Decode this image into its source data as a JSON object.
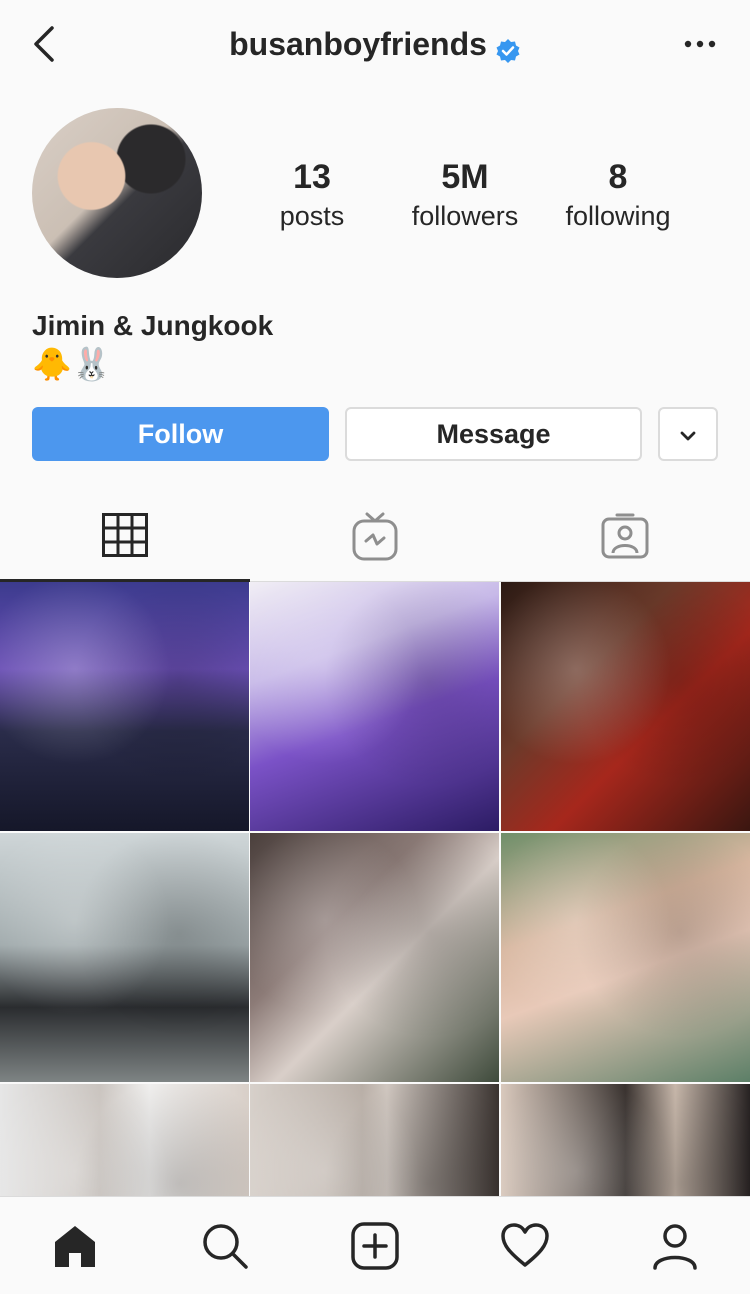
{
  "header": {
    "username": "busanboyfriends"
  },
  "profile": {
    "stats": [
      {
        "value": "13",
        "label": "posts"
      },
      {
        "value": "5M",
        "label": "followers"
      },
      {
        "value": "8",
        "label": "following"
      }
    ],
    "name": "Jimin & Jungkook",
    "bio": "🐥🐰"
  },
  "actions": {
    "follow_label": "Follow",
    "message_label": "Message"
  },
  "tabs": [
    "grid-tab",
    "igtv-tab",
    "tagged-tab"
  ],
  "bottom_nav": [
    "home-icon",
    "search-icon",
    "new-post-icon",
    "activity-icon",
    "profile-icon"
  ],
  "colors": {
    "accent": "#4c97ee",
    "verified": "#3797f0"
  }
}
